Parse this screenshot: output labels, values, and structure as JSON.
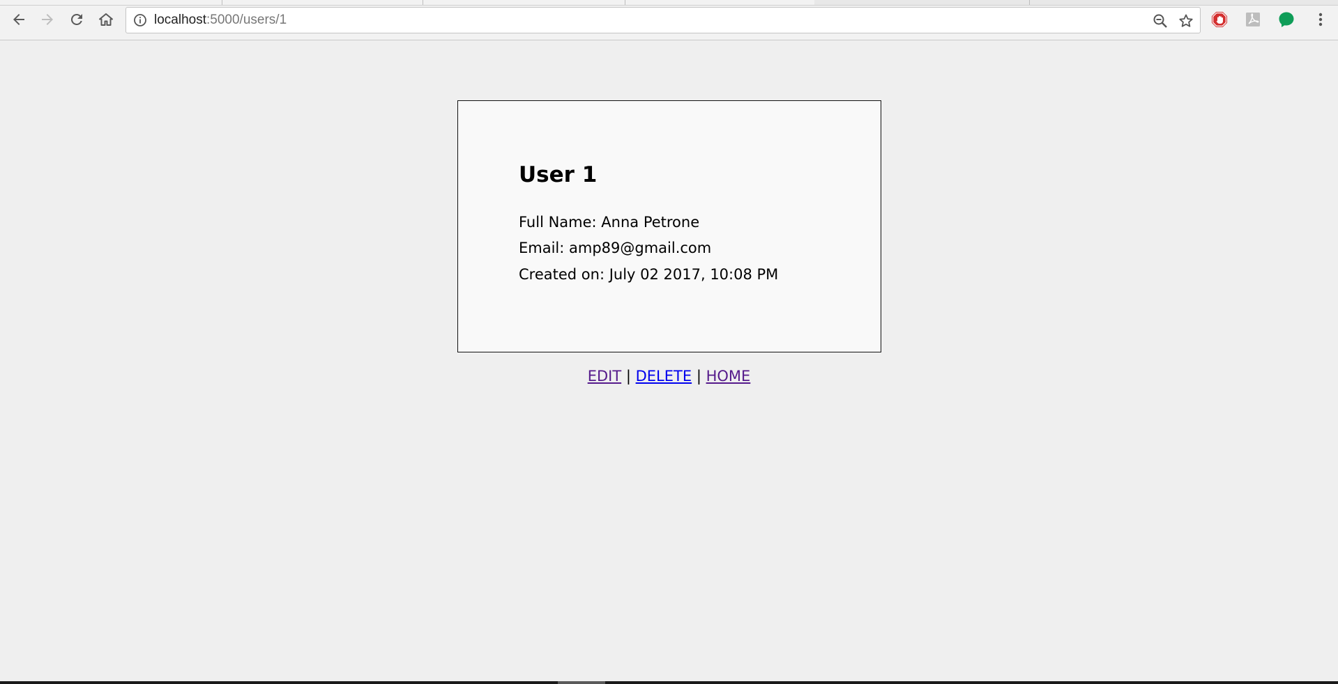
{
  "browser": {
    "url_host": "localhost",
    "url_path": ":5000/users/1",
    "icons": {
      "back": "back-arrow-icon",
      "forward": "forward-arrow-icon",
      "reload": "reload-icon",
      "home": "home-icon",
      "info": "info-icon",
      "zoom": "zoom-out-icon",
      "bookmark": "star-icon",
      "ext_adblock": "stop-hand-icon",
      "ext_pdf": "pdf-icon",
      "ext_chat": "chat-bubble-icon",
      "menu": "kebab-menu-icon"
    },
    "colors": {
      "adblock": "#d32f2f",
      "chat": "#0f9d58"
    }
  },
  "user": {
    "title": "User 1",
    "full_name": "Full Name: Anna Petrone",
    "email": "Email: amp89@gmail.com",
    "created_on": "Created on: July 02 2017, 10:08 PM"
  },
  "links": {
    "edit": "EDIT",
    "delete": "DELETE",
    "home": "HOME",
    "separator": "|"
  },
  "colors": {
    "page_bg": "#efefef",
    "card_bg": "#f9f9f9",
    "link_visited": "#551a8b",
    "link_unvisited": "#0000ee"
  }
}
